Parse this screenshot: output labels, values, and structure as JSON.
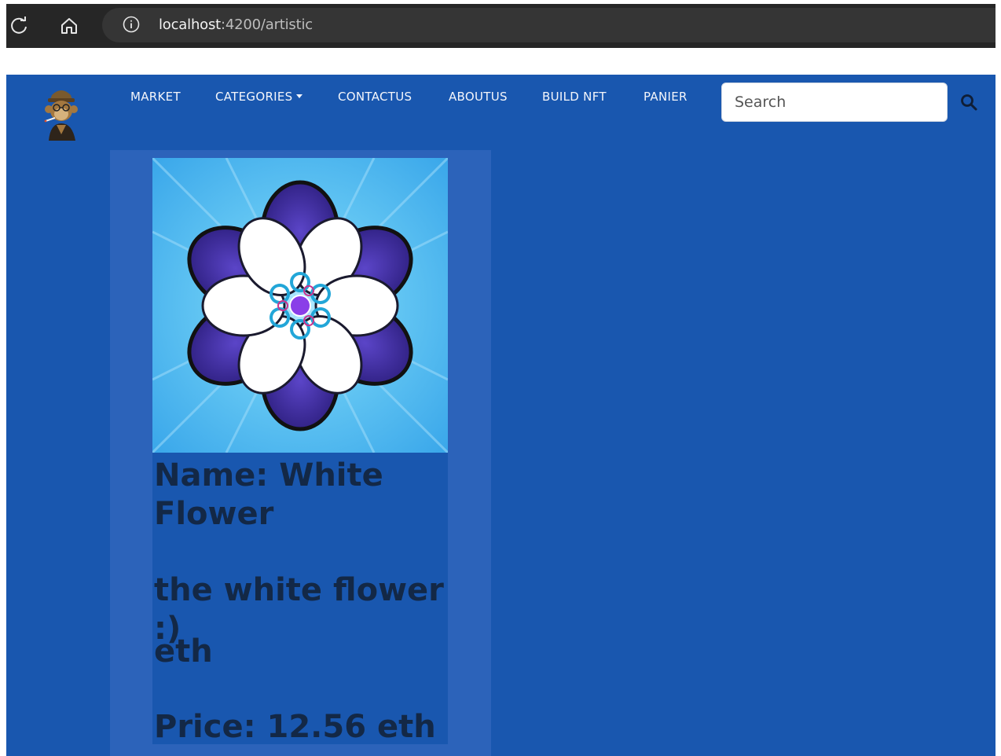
{
  "browser": {
    "url_host": "localhost",
    "url_path": ":4200/artistic",
    "icons": [
      "refresh-icon",
      "home-icon",
      "info-icon"
    ]
  },
  "navbar": {
    "logo": "ape-avatar-logo",
    "items": [
      {
        "label": "MARKET"
      },
      {
        "label": "CATEGORIES",
        "has_dropdown": true
      },
      {
        "label": "CONTACTUS"
      },
      {
        "label": "ABOUTUS"
      },
      {
        "label": "BUILD NFT"
      },
      {
        "label": "PANIER"
      }
    ],
    "search": {
      "placeholder": "Search",
      "value": ""
    },
    "search_icon": "search-icon"
  },
  "card": {
    "image_alt": "White Flower",
    "name_label": "Name: White Flower",
    "description": "the white flower :)",
    "unit": "eth",
    "price_label": "Price: 12.56 eth"
  },
  "colors": {
    "page_bg": "#1957af",
    "column_bg": "#2c63ba",
    "card_text": "#132846",
    "browser_bar": "#262626"
  }
}
